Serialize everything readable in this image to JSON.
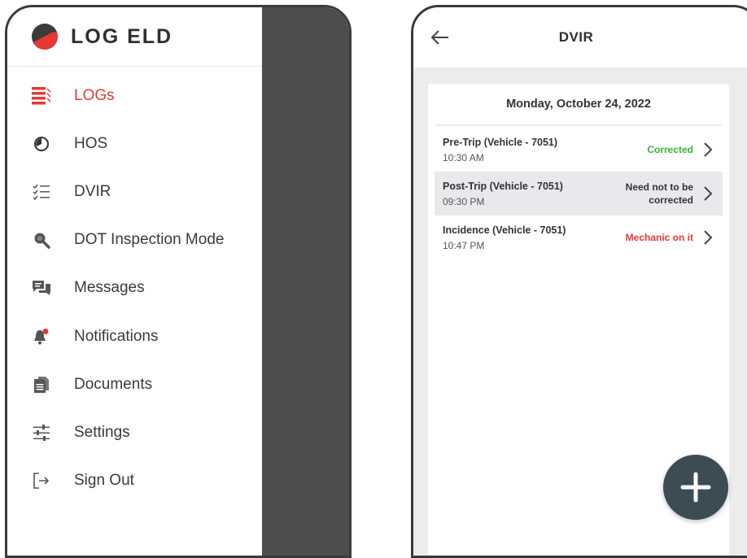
{
  "drawer": {
    "brand": "LOG ELD",
    "brand_icon": "log-eld-logo",
    "menu": [
      {
        "label": "LOGs",
        "icon": "logs-list-icon",
        "active": true
      },
      {
        "label": "HOS",
        "icon": "clock-icon"
      },
      {
        "label": "DVIR",
        "icon": "checklist-icon"
      },
      {
        "label": "DOT Inspection Mode",
        "icon": "magnifier-icon"
      },
      {
        "label": "Messages",
        "icon": "chat-icon"
      },
      {
        "label": "Notifications",
        "icon": "bell-icon"
      },
      {
        "label": "Documents",
        "icon": "documents-icon"
      },
      {
        "label": "Settings",
        "icon": "sliders-icon"
      },
      {
        "label": "Sign Out",
        "icon": "sign-out-icon"
      }
    ]
  },
  "dvir": {
    "title": "DVIR",
    "date": "Monday, October 24, 2022",
    "reports": [
      {
        "title": "Pre-Trip (Vehicle - 7051)",
        "time": "10:30 AM",
        "status": "Corrected",
        "status_color": "#3cb043"
      },
      {
        "title": "Post-Trip (Vehicle - 7051)",
        "time": "09:30 PM",
        "status_line1": "Need not to be",
        "status_line2": "corrected",
        "status_color": "#333333"
      },
      {
        "title": "Incidence (Vehicle - 7051)",
        "time": "10:47 PM",
        "status": "Mechanic on it",
        "status_color": "#e53935"
      }
    ]
  },
  "colors": {
    "accent": "#e53935",
    "fab": "#3d4b53",
    "scrim": "#4d4d4d"
  }
}
